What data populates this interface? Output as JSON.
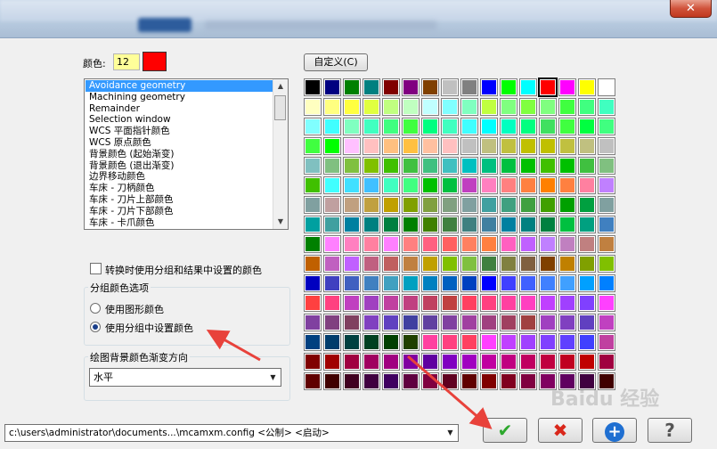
{
  "window": {
    "close_glyph": "✕"
  },
  "color_label": "颜色:",
  "color_number": "12",
  "selected_color": "#ff0000",
  "custom_button": "自定义(C)",
  "list_items": [
    "Avoidance geometry",
    "Machining geometry",
    "Remainder",
    "Selection window",
    "WCS 平面指针颜色",
    "WCS 原点颜色",
    "背景颜色 (起始渐变)",
    "背景颜色 (退出渐变)",
    "边界移动颜色",
    "车床 - 刀柄颜色",
    "车床 - 刀片上部颜色",
    "车床 - 刀片下部颜色",
    "车床 - 卡爪颜色"
  ],
  "checkbox_label": "转换时使用分组和结果中设置的颜色",
  "group_colors": {
    "title": "分组颜色选项",
    "option1": "使用图形颜色",
    "option2": "使用分组中设置颜色",
    "selected": 2
  },
  "gradient": {
    "title": "绘图背景颜色渐变方向",
    "value": "水平"
  },
  "path_text": "c:\\users\\administrator\\documents...\\mcamxm.config <公制> <启动>",
  "buttons": {
    "ok": "✔",
    "cancel": "✖",
    "help": "?",
    "add": "+"
  },
  "watermark": "Baidu 经验",
  "palette_rows": [
    [
      "#000000",
      "#000080",
      "#008000",
      "#008080",
      "#800000",
      "#800080",
      "#804000",
      "#c0c0c0",
      "#808080",
      "#0000ff",
      "#00ff00",
      "#00ffff",
      "#ff0000",
      "#ff00ff",
      "#ffff00",
      "#ffffff"
    ],
    [
      "#ffffc0",
      "#ffff80",
      "#ffff40",
      "#e0ff40",
      "#c0ff80",
      "#c0ffc0",
      "#c0ffff",
      "#80ffff",
      "#80ffc0",
      "#c0ff40",
      "#80ff80",
      "#80ff40",
      "#80ff80",
      "#40ff40",
      "#40ff80",
      "#40ffc0"
    ],
    [
      "#80ffff",
      "#40ffff",
      "#80ffc0",
      "#40ffc0",
      "#40ff80",
      "#40ff40",
      "#00ff80",
      "#40ffc0",
      "#40ffff",
      "#00ffff",
      "#00ffc0",
      "#00ff80",
      "#40e060",
      "#40ff40",
      "#00ff40",
      "#40ff80"
    ],
    [
      "#40ff40",
      "#00ff00",
      "#ffc0ff",
      "#ffc0c0",
      "#ffc080",
      "#ffc040",
      "#ffc0a0",
      "#ffc0c0",
      "#c0c0c0",
      "#c0c080",
      "#c0c040",
      "#c0c000",
      "#c0c000",
      "#c0c040",
      "#c0c080",
      "#c0c0c0"
    ],
    [
      "#80c0c0",
      "#80c080",
      "#80c040",
      "#80c000",
      "#40c000",
      "#40c040",
      "#40c080",
      "#40c0c0",
      "#00c0c0",
      "#00c080",
      "#00c040",
      "#00c000",
      "#40c000",
      "#00c000",
      "#40c040",
      "#80c080"
    ],
    [
      "#40c000",
      "#40ffff",
      "#40e0ff",
      "#40c0ff",
      "#40ffc0",
      "#40ff80",
      "#00c000",
      "#00c040",
      "#c040c0",
      "#ff80c0",
      "#ff8080",
      "#ff8040",
      "#ff8000",
      "#ff8040",
      "#ff80a0",
      "#c080ff"
    ],
    [
      "#80a0a0",
      "#c0a0a0",
      "#c0a080",
      "#c0a040",
      "#c0a000",
      "#80a000",
      "#80a040",
      "#80a080",
      "#80a0a0",
      "#40a0a0",
      "#40a080",
      "#40a040",
      "#40a000",
      "#00a000",
      "#00a040",
      "#80a0a0"
    ],
    [
      "#00a0a0",
      "#40a0a0",
      "#0080a0",
      "#008080",
      "#008040",
      "#008000",
      "#408000",
      "#408040",
      "#408080",
      "#4080a0",
      "#0080a0",
      "#008080",
      "#008040",
      "#00c040",
      "#00a080",
      "#4080c0"
    ],
    [
      "#008000",
      "#ff80ff",
      "#ff80c0",
      "#ff80a0",
      "#ff80ff",
      "#ff8080",
      "#ff6080",
      "#ff6060",
      "#ff8060",
      "#ff8040",
      "#ff60c0",
      "#c060ff",
      "#c080ff",
      "#c080c0",
      "#c08080",
      "#c08040"
    ],
    [
      "#c06000",
      "#c060c0",
      "#c060ff",
      "#c06080",
      "#c06060",
      "#c08040",
      "#c0a000",
      "#80c000",
      "#80c040",
      "#408040",
      "#808040",
      "#806040",
      "#804000",
      "#c08000",
      "#80a000",
      "#80c000"
    ],
    [
      "#0000c0",
      "#4040c0",
      "#4060c0",
      "#4080c0",
      "#40a0c0",
      "#00a0c0",
      "#0080c0",
      "#0060c0",
      "#0040c0",
      "#0000ff",
      "#4040ff",
      "#4060ff",
      "#4080ff",
      "#40a0ff",
      "#00a0ff",
      "#0080ff"
    ],
    [
      "#ff4040",
      "#ff4080",
      "#c040c0",
      "#a040c0",
      "#c040a0",
      "#c04080",
      "#c04060",
      "#c04040",
      "#ff4060",
      "#ff4080",
      "#ff40a0",
      "#ff40c0",
      "#c040ff",
      "#a040ff",
      "#8040ff",
      "#ff40ff"
    ],
    [
      "#8040a0",
      "#804080",
      "#804060",
      "#8040c0",
      "#6040c0",
      "#4040a0",
      "#6040a0",
      "#8040a0",
      "#a040a0",
      "#a04080",
      "#a04060",
      "#a04040",
      "#a040c0",
      "#8040c0",
      "#6040c0",
      "#c040c0"
    ],
    [
      "#004080",
      "#003c6c",
      "#004040",
      "#004020",
      "#004000",
      "#204000",
      "#ff40a0",
      "#ff4080",
      "#ff4060",
      "#ff40ff",
      "#c040ff",
      "#a040ff",
      "#8040ff",
      "#6040ff",
      "#4040ff",
      "#c040a0"
    ],
    [
      "#800000",
      "#a00000",
      "#a00040",
      "#a00060",
      "#a00080",
      "#8000a0",
      "#6000a0",
      "#8000c0",
      "#a000c0",
      "#c000a0",
      "#c00080",
      "#c00060",
      "#c00040",
      "#c00020",
      "#c00000",
      "#a00040"
    ],
    [
      "#600000",
      "#400000",
      "#400020",
      "#400040",
      "#400060",
      "#600040",
      "#800040",
      "#600020",
      "#600000",
      "#800000",
      "#800020",
      "#800040",
      "#800060",
      "#600060",
      "#400040",
      "#400000"
    ]
  ]
}
